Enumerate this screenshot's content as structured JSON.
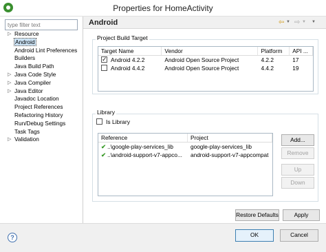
{
  "window": {
    "title": "Properties for HomeActivity",
    "app_icon": "eclipse-icon"
  },
  "filter": {
    "placeholder": "type filter text"
  },
  "tree": [
    {
      "label": "Resource",
      "expandable": true
    },
    {
      "label": "Android",
      "expandable": false,
      "selected": true
    },
    {
      "label": "Android Lint Preferences",
      "expandable": false
    },
    {
      "label": "Builders",
      "expandable": false
    },
    {
      "label": "Java Build Path",
      "expandable": false
    },
    {
      "label": "Java Code Style",
      "expandable": true
    },
    {
      "label": "Java Compiler",
      "expandable": true
    },
    {
      "label": "Java Editor",
      "expandable": true
    },
    {
      "label": "Javadoc Location",
      "expandable": false
    },
    {
      "label": "Project References",
      "expandable": false
    },
    {
      "label": "Refactoring History",
      "expandable": false
    },
    {
      "label": "Run/Debug Settings",
      "expandable": false
    },
    {
      "label": "Task Tags",
      "expandable": false
    },
    {
      "label": "Validation",
      "expandable": true
    }
  ],
  "page": {
    "title": "Android"
  },
  "build_target": {
    "legend": "Project Build Target",
    "headers": [
      "Target Name",
      "Vendor",
      "Platform",
      "API ..."
    ],
    "rows": [
      {
        "checked": true,
        "name": "Android 4.2.2",
        "vendor": "Android Open Source Project",
        "platform": "4.2.2",
        "api": "17"
      },
      {
        "checked": false,
        "name": "Android 4.4.2",
        "vendor": "Android Open Source Project",
        "platform": "4.4.2",
        "api": "19"
      }
    ]
  },
  "library": {
    "legend": "Library",
    "is_library_label": "Is Library",
    "is_library_checked": false,
    "headers": [
      "Reference",
      "Project"
    ],
    "rows": [
      {
        "reference": "..\\google-play-services_lib",
        "project": "google-play-services_lib"
      },
      {
        "reference": "..\\android-support-v7-appco...",
        "project": "android-support-v7-appcompat"
      }
    ],
    "buttons": {
      "add": "Add...",
      "remove": "Remove",
      "up": "Up",
      "down": "Down"
    }
  },
  "actions": {
    "restore_defaults": "Restore Defaults",
    "apply": "Apply",
    "ok": "OK",
    "cancel": "Cancel"
  },
  "help": {
    "label": "?"
  },
  "colors": {
    "selection": "#cce4f7",
    "ok_check": "#3a9b2a",
    "nav_back": "#d09a1a"
  }
}
